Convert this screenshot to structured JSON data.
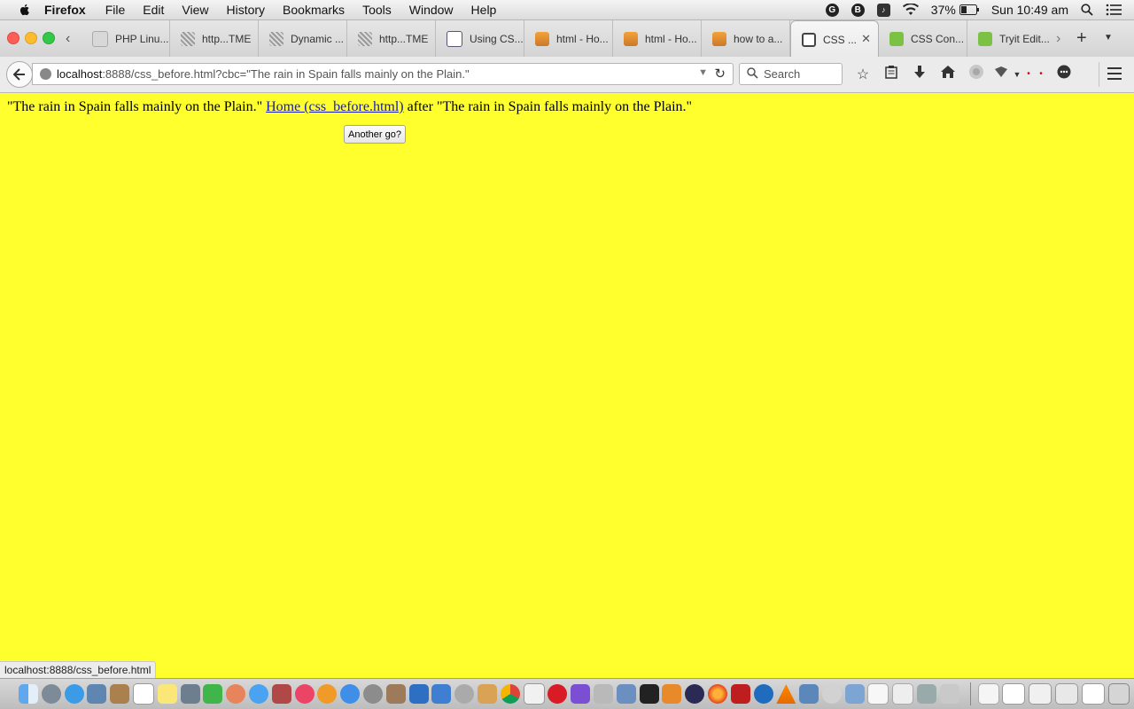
{
  "menubar": {
    "app_name": "Firefox",
    "items": [
      "File",
      "Edit",
      "View",
      "History",
      "Bookmarks",
      "Tools",
      "Window",
      "Help"
    ],
    "status": {
      "battery": "37%",
      "clock": "Sun 10:49 am"
    }
  },
  "tabs": [
    {
      "title": "PHP Linu...",
      "icon": "blank-page-icon"
    },
    {
      "title": "http...TME",
      "icon": "striped-page-icon"
    },
    {
      "title": "Dynamic ...",
      "icon": "striped-page-icon"
    },
    {
      "title": "http...TME",
      "icon": "striped-page-icon"
    },
    {
      "title": "Using CS...",
      "icon": "document-icon"
    },
    {
      "title": "html - Ho...",
      "icon": "stackoverflow-icon"
    },
    {
      "title": "html - Ho...",
      "icon": "stackoverflow-icon"
    },
    {
      "title": "how to a...",
      "icon": "stackoverflow-icon"
    },
    {
      "title": "CSS ...",
      "icon": "globe-icon",
      "active": true
    },
    {
      "title": "CSS Con...",
      "icon": "w3schools-icon"
    },
    {
      "title": "Tryit Edit...",
      "icon": "w3schools-icon"
    }
  ],
  "toolbar": {
    "url_host": "localhost",
    "url_rest": ":8888/css_before.html?cbc=\"The rain in Spain falls mainly on the Plain.\"",
    "search_placeholder": "Search"
  },
  "page": {
    "text_before": "\"The rain in Spain falls mainly on the Plain.\" ",
    "link_text": "Home (css_before.html)",
    "text_after": " after \"The rain in Spain falls mainly on the Plain.\"",
    "button_label": "Another go?",
    "background_color": "#ffff2e"
  },
  "statusbar": {
    "url": "localhost:8888/css_before.html"
  }
}
